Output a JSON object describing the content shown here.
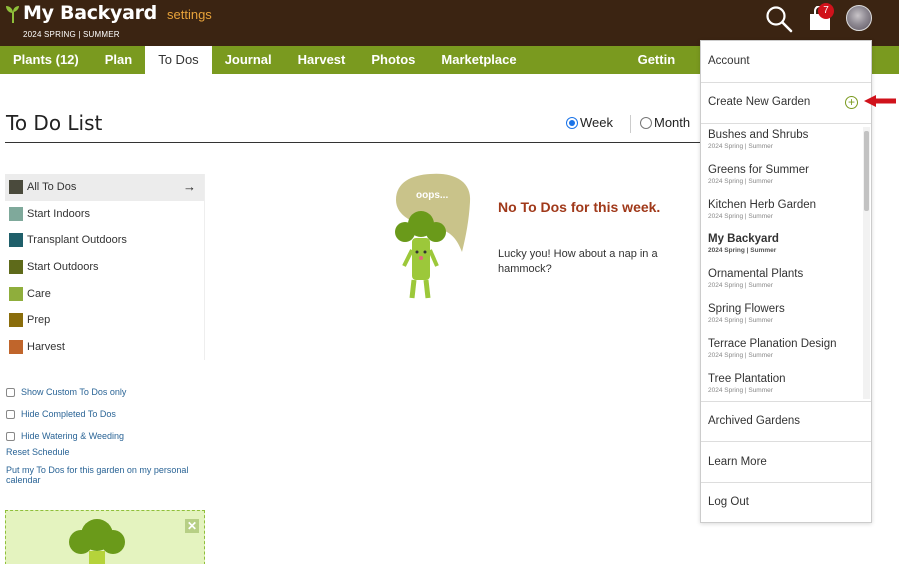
{
  "app": {
    "title": "My Backyard",
    "settings_link": "settings",
    "season": "2024 SPRING | SUMMER",
    "cart_count": "7",
    "accent_color": "#7a9a1f",
    "header_color": "#3b2412"
  },
  "nav": {
    "items": [
      {
        "label": "Plants (12)"
      },
      {
        "label": "Plan"
      },
      {
        "label": "To Dos",
        "active": true
      },
      {
        "label": "Journal"
      },
      {
        "label": "Harvest"
      },
      {
        "label": "Photos"
      },
      {
        "label": "Marketplace"
      },
      {
        "label": "Gettin"
      }
    ]
  },
  "main": {
    "title": "To Do List",
    "range": {
      "week": "Week",
      "month": "Month",
      "selected": "week"
    }
  },
  "categories": [
    {
      "label": "All To Dos",
      "color": "#4a4a3c",
      "selected": true
    },
    {
      "label": "Start Indoors",
      "color": "#7fa99b"
    },
    {
      "label": "Transplant Outdoors",
      "color": "#1f5f6a"
    },
    {
      "label": "Start Outdoors",
      "color": "#5e6a1a"
    },
    {
      "label": "Care",
      "color": "#8fae3c"
    },
    {
      "label": "Prep",
      "color": "#8a6d0b"
    },
    {
      "label": "Harvest",
      "color": "#c0652b"
    }
  ],
  "options": {
    "custom_only": "Show Custom To Dos only",
    "hide_completed": "Hide Completed To Dos",
    "hide_watering": "Hide Watering & Weeding",
    "reset": "Reset Schedule",
    "calendar": "Put my To Dos for this garden on my personal calendar"
  },
  "empty": {
    "bubble": "oops...",
    "title": "No To Dos for this week.",
    "text": "Lucky you! How about a nap in a hammock?"
  },
  "dropdown": {
    "account": "Account",
    "create": "Create New Garden",
    "gardens": [
      {
        "name": "Bushes and Shrubs",
        "season": "2024 Spring | Summer"
      },
      {
        "name": "Greens for Summer",
        "season": "2024 Spring | Summer"
      },
      {
        "name": "Kitchen Herb Garden",
        "season": "2024 Spring | Summer"
      },
      {
        "name": "My Backyard",
        "season": "2024 Spring | Summer",
        "current": true
      },
      {
        "name": "Ornamental Plants",
        "season": "2024 Spring | Summer"
      },
      {
        "name": "Spring Flowers",
        "season": "2024 Spring | Summer"
      },
      {
        "name": "Terrace Planation Design",
        "season": "2024 Spring | Summer"
      },
      {
        "name": "Tree Plantation",
        "season": "2024 Spring | Summer"
      }
    ],
    "archived": "Archived Gardens",
    "learn": "Learn More",
    "logout": "Log Out"
  }
}
